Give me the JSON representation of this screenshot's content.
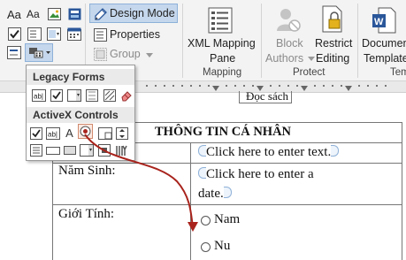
{
  "ribbon": {
    "left": {
      "aa1": "Aa",
      "aa2": "Aa"
    },
    "controls": {
      "design_mode": "Design Mode",
      "properties": "Properties",
      "group": "Group"
    },
    "mapping": {
      "xml_line1": "XML Mapping",
      "xml_line2": "Pane",
      "group_label": "Mapping"
    },
    "protect": {
      "block_line1": "Block",
      "block_line2": "Authors",
      "restrict_line1": "Restrict",
      "restrict_line2": "Editing",
      "group_label": "Protect"
    },
    "templates": {
      "doc_line1": "Document",
      "doc_line2": "Template",
      "group_label": "Tem"
    }
  },
  "popup": {
    "legacy_header": "Legacy Forms",
    "activex_header": "ActiveX Controls",
    "text_field": "ab|",
    "label_a": "A"
  },
  "doc": {
    "hidden_text": "Đọc sách",
    "header": "THÔNG TIN CÁ NHÂN",
    "row1_placeholder": "Click here to enter text.",
    "row2_label": "Năm Sinh:",
    "row2_line1": "Click here to enter a",
    "row2_line2": "date.",
    "row3_label": "Giới Tính:",
    "opt1": "Nam",
    "opt2": "Nu"
  },
  "colors": {
    "accent": "#2b579a",
    "arrow": "#a8231c",
    "placeholder": "#eef4fb"
  }
}
